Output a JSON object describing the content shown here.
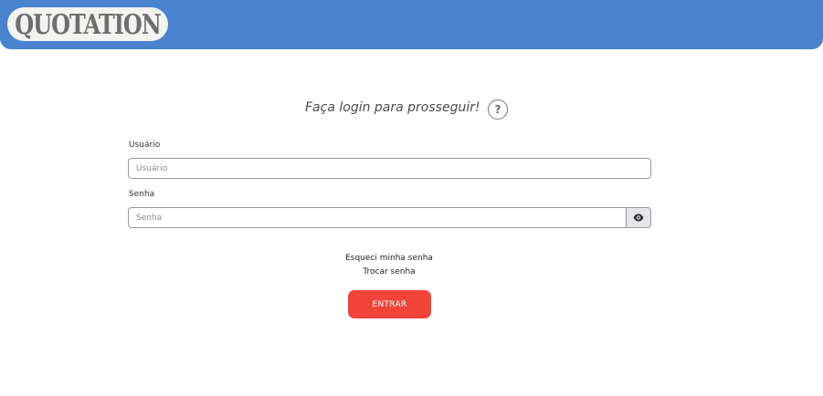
{
  "header": {
    "logo_text": "QUOTATION"
  },
  "login": {
    "prompt": "Faça login para prosseguir!",
    "help_symbol": "?",
    "username": {
      "label": "Usuário",
      "placeholder": "Usuário",
      "value": ""
    },
    "password": {
      "label": "Senha",
      "placeholder": "Senha",
      "value": ""
    },
    "forgot_password_link": "Esqueci minha senha",
    "change_password_link": "Trocar senha",
    "submit_label": "ENTRAR"
  },
  "colors": {
    "header_bg": "#4a84d0",
    "submit_bg": "#f24438",
    "eye_button_bg": "#e4e6e9"
  },
  "icons": {
    "help": "question-circle-icon",
    "toggle_password": "eye-icon"
  }
}
